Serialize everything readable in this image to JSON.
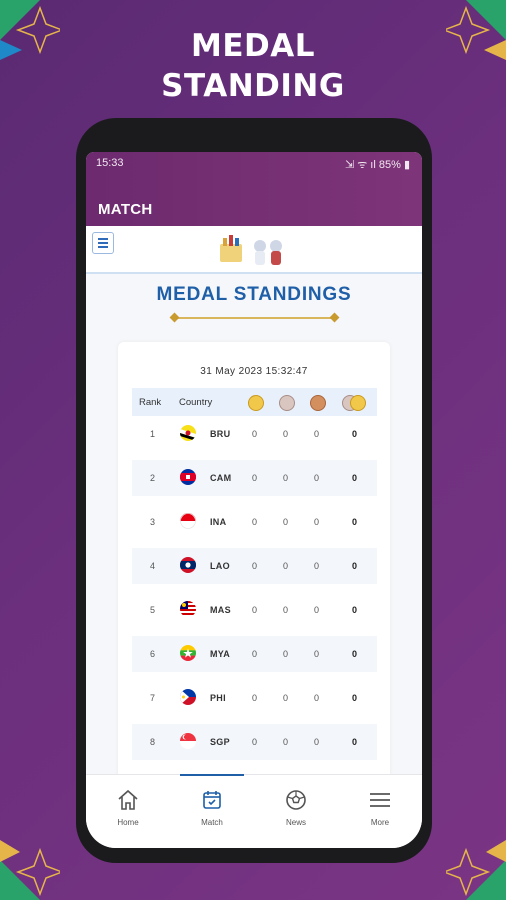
{
  "promo": {
    "title_line1": "MEDAL",
    "title_line2": "STANDING"
  },
  "status_bar": {
    "time": "15:33",
    "indicators": "⇲ ᯤ ıl 85% ▮"
  },
  "app_bar": {
    "title": "MATCH"
  },
  "page": {
    "heading": "MEDAL STANDINGS",
    "timestamp": "31 May 2023  15:32:47"
  },
  "table": {
    "headers": {
      "rank": "Rank",
      "country": "Country"
    },
    "medal_icons": [
      "gold-medal-icon",
      "silver-medal-icon",
      "bronze-medal-icon",
      "total-medals-icon"
    ],
    "rows": [
      {
        "rank": "1",
        "code": "BRU",
        "gold": "0",
        "silver": "0",
        "bronze": "0",
        "total": "0"
      },
      {
        "rank": "2",
        "code": "CAM",
        "gold": "0",
        "silver": "0",
        "bronze": "0",
        "total": "0"
      },
      {
        "rank": "3",
        "code": "INA",
        "gold": "0",
        "silver": "0",
        "bronze": "0",
        "total": "0"
      },
      {
        "rank": "4",
        "code": "LAO",
        "gold": "0",
        "silver": "0",
        "bronze": "0",
        "total": "0"
      },
      {
        "rank": "5",
        "code": "MAS",
        "gold": "0",
        "silver": "0",
        "bronze": "0",
        "total": "0"
      },
      {
        "rank": "6",
        "code": "MYA",
        "gold": "0",
        "silver": "0",
        "bronze": "0",
        "total": "0"
      },
      {
        "rank": "7",
        "code": "PHI",
        "gold": "0",
        "silver": "0",
        "bronze": "0",
        "total": "0"
      },
      {
        "rank": "8",
        "code": "SGP",
        "gold": "0",
        "silver": "0",
        "bronze": "0",
        "total": "0"
      }
    ]
  },
  "bottom_nav": {
    "items": [
      {
        "label": "Home",
        "icon": "home-icon"
      },
      {
        "label": "Match",
        "icon": "calendar-icon"
      },
      {
        "label": "News",
        "icon": "football-icon"
      },
      {
        "label": "More",
        "icon": "hamburger-menu-icon"
      }
    ],
    "active_index": 1
  },
  "colors": {
    "background": "#6b2f7d",
    "app_bar": "#7e3478",
    "heading_blue": "#1e5fa8",
    "gold_accent": "#d9b65b",
    "row_alt": "#f3f6fb"
  }
}
